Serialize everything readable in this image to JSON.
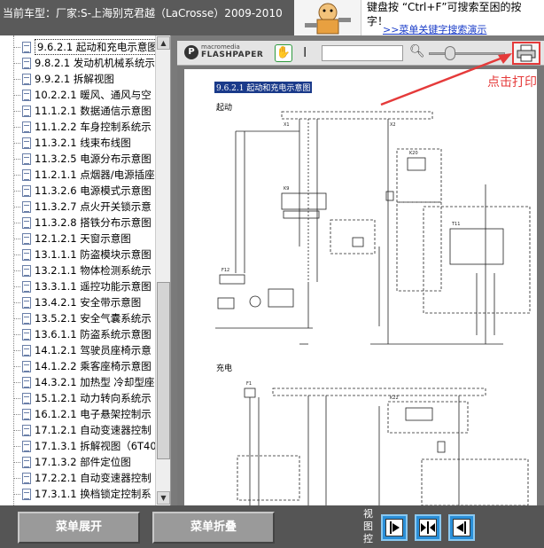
{
  "header": {
    "car_title": "当前车型：厂家:S-上海别克君越（LaCrosse）2009-2010",
    "hint_text": "键盘按 “Ctrl+F”可搜索至困的按\n字！",
    "hint_link": ">>菜单关键字搜索演示"
  },
  "tree": {
    "items": [
      "9.6.2.1 起动和充电示意图",
      "9.8.2.1 发动机机械系统示",
      "9.9.2.1 拆解视图",
      "10.2.2.1 暖风、通风与空",
      "11.1.2.1 数据通信示意图",
      "11.1.2.2 车身控制系统示",
      "11.3.2.1 线束布线图",
      "11.3.2.5 电源分布示意图",
      "11.2.1.1 点烟器/电源插座",
      "11.3.2.6 电源模式示意图",
      "11.3.2.7 点火开关锁示意",
      "11.3.2.8 搭铁分布示意图",
      "12.1.2.1 天窗示意图",
      "13.1.1.1 防盗模块示意图",
      "13.2.1.1 物体检测系统示",
      "13.3.1.1 遥控功能示意图",
      "13.4.2.1 安全带示意图",
      "13.5.2.1 安全气囊系统示",
      "13.6.1.1 防盗系统示意图",
      "14.1.2.1 驾驶员座椅示意",
      "14.1.2.2 乘客座椅示意图",
      "14.3.2.1 加热型 冷却型座",
      "15.1.2.1 动力转向系统示",
      "16.1.2.1 电子悬架控制示",
      "17.1.2.1 自动变速器控制",
      "17.1.3.1 拆解视图（6T40",
      "17.1.3.2 部件定位图",
      "17.2.2.1 自动变速器控制",
      "17.3.1.1 换档锁定控制系"
    ]
  },
  "viewer": {
    "brand_top": "macromedia",
    "brand_bottom": "FLASHPAPER",
    "page_title": "9.6.2.1 起动和充电示意图",
    "section_start": "起动",
    "section_charge": "充电"
  },
  "annotation": "点击打印",
  "bottom": {
    "expand_label": "菜单展开",
    "collapse_label": "菜单折叠",
    "view_label": "视图控"
  },
  "colors": {
    "annotation_red": "#e53a3a",
    "link_blue": "#1a3cc8",
    "view_button_blue": "#2a8fd8"
  }
}
